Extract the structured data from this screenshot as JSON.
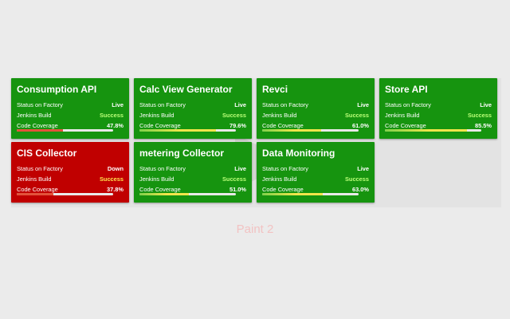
{
  "watermark_text": "Paint 2",
  "colors": {
    "card_ok": "#16940f",
    "card_fail": "#c00000",
    "bar_track": "#e9e9e9"
  },
  "cards": [
    {
      "title": "Consumption API",
      "state": "ok",
      "status_label": "Status on Factory",
      "status_value": "Live",
      "build_label": "Jenkins Build",
      "build_value": "Success",
      "coverage_label": "Code Coverage",
      "coverage_value": "47.8%",
      "coverage_pct": 47.8,
      "bar_color": "#e2533b"
    },
    {
      "title": "Calc View Generator",
      "state": "ok",
      "status_label": "Status on Factory",
      "status_value": "Live",
      "build_label": "Jenkins Build",
      "build_value": "Success",
      "coverage_label": "Code Coverage",
      "coverage_value": "79.6%",
      "coverage_pct": 79.6,
      "bar_color": "gradient"
    },
    {
      "title": "Revci",
      "state": "ok",
      "status_label": "Status on Factory",
      "status_value": "Live",
      "build_label": "Jenkins Build",
      "build_value": "Success",
      "coverage_label": "Code Coverage",
      "coverage_value": "61.0%",
      "coverage_pct": 61.0,
      "bar_color": "gradient"
    },
    {
      "title": "Store API",
      "state": "ok",
      "status_label": "Status on Factory",
      "status_value": "Live",
      "build_label": "Jenkins Build",
      "build_value": "Success",
      "coverage_label": "Code Coverage",
      "coverage_value": "85.5%",
      "coverage_pct": 85.5,
      "bar_color": "gradient"
    },
    {
      "title": "CIS Collector",
      "state": "fail",
      "status_label": "Status on Factory",
      "status_value": "Down",
      "build_label": "Jenkins Build",
      "build_value": "Success",
      "coverage_label": "Code Coverage",
      "coverage_value": "37.8%",
      "coverage_pct": 37.8,
      "bar_color": "#e2533b"
    },
    {
      "title": "metering Collector",
      "state": "ok",
      "status_label": "Status on Factory",
      "status_value": "Live",
      "build_label": "Jenkins Build",
      "build_value": "Success",
      "coverage_label": "Code Coverage",
      "coverage_value": "51.0%",
      "coverage_pct": 51.0,
      "bar_color": "gradient"
    },
    {
      "title": "Data Monitoring",
      "state": "ok",
      "status_label": "Status on Factory",
      "status_value": "Live",
      "build_label": "Jenkins Build",
      "build_value": "Success",
      "coverage_label": "Code Coverage",
      "coverage_value": "63.0%",
      "coverage_pct": 63.0,
      "bar_color": "gradient"
    }
  ]
}
